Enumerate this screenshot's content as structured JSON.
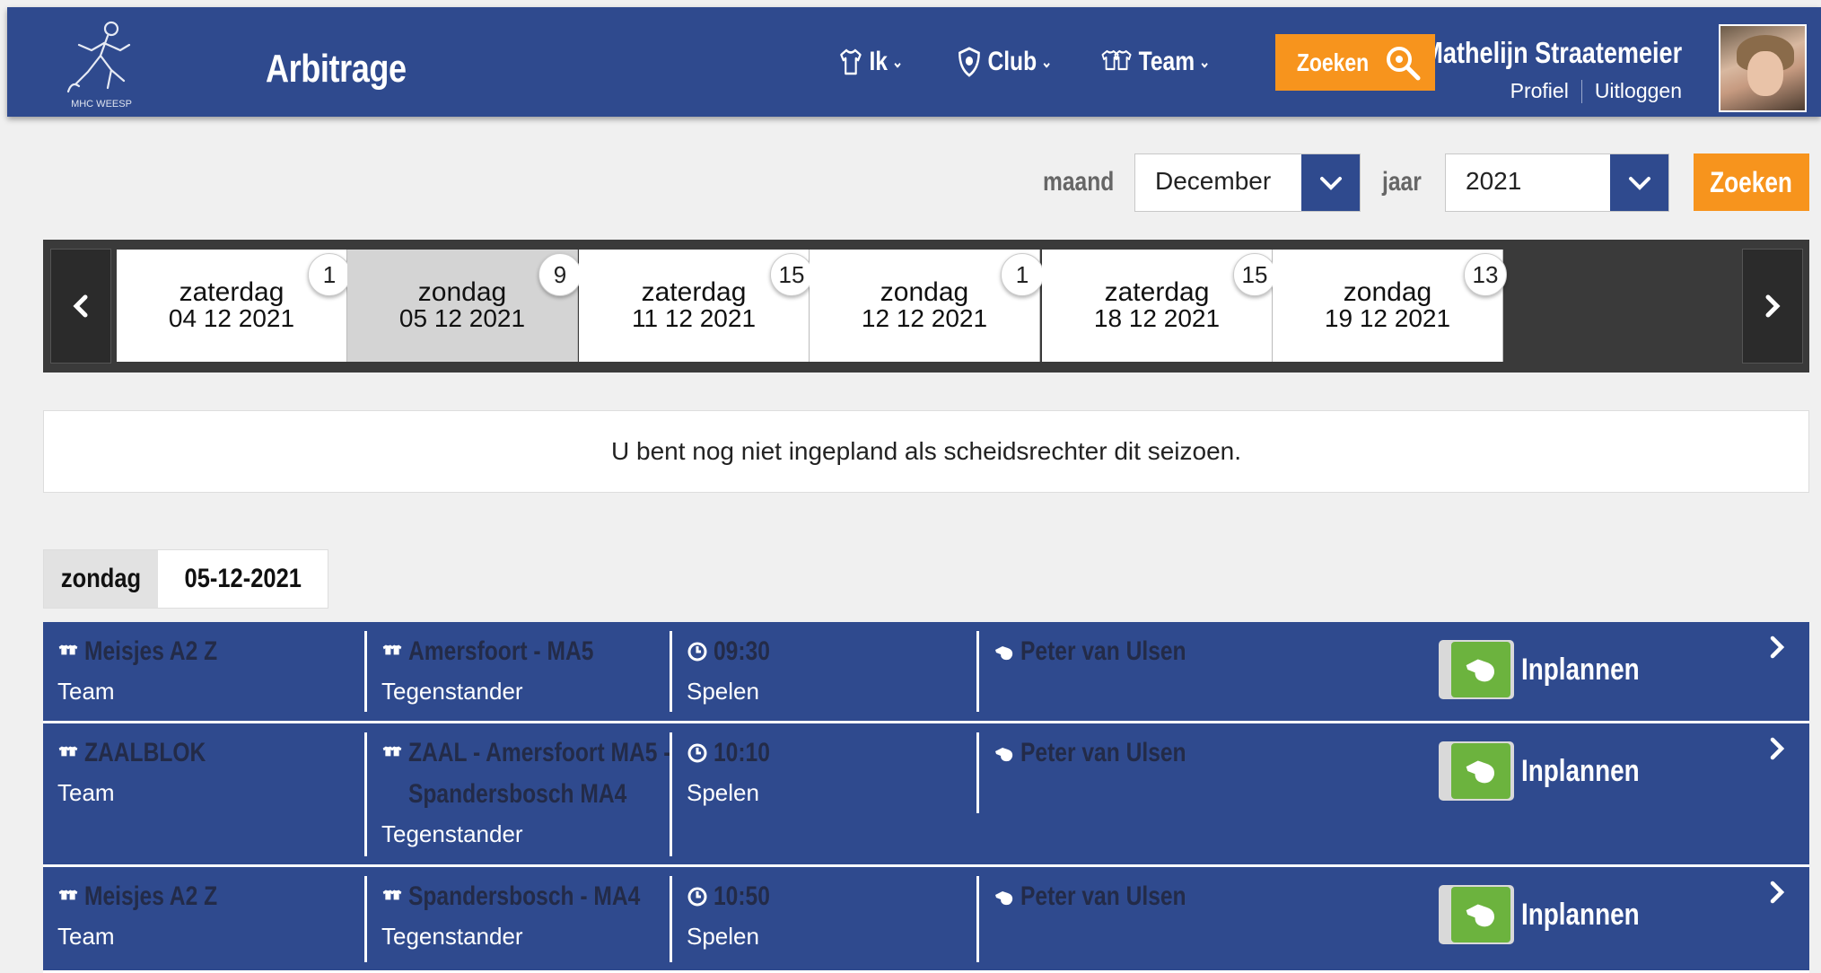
{
  "header": {
    "logo_text": "MHC WEESP",
    "title": "Arbitrage",
    "nav": [
      {
        "label": "Ik",
        "icon": "shirt-icon"
      },
      {
        "label": "Club",
        "icon": "shield-icon"
      },
      {
        "label": "Team",
        "icon": "team-shirts-icon"
      }
    ],
    "search_label": "Zoeken",
    "user_name": "Mathelijn Straatemeier",
    "profile_label": "Profiel",
    "logout_label": "Uitloggen"
  },
  "filters": {
    "month_label": "maand",
    "month_value": "December",
    "year_label": "jaar",
    "year_value": "2021",
    "search_label": "Zoeken"
  },
  "days": [
    {
      "name": "zaterdag",
      "date": "04 12 2021",
      "count": "1"
    },
    {
      "name": "zondag",
      "date": "05 12 2021",
      "count": "9",
      "active": true
    },
    {
      "name": "zaterdag",
      "date": "11 12 2021",
      "count": "15"
    },
    {
      "name": "zondag",
      "date": "12 12 2021",
      "count": "1"
    },
    {
      "name": "zaterdag",
      "date": "18 12 2021",
      "count": "15"
    },
    {
      "name": "zondag",
      "date": "19 12 2021",
      "count": "13"
    }
  ],
  "message": "U bent nog niet ingepland als scheidsrechter dit seizoen.",
  "day_header": {
    "weekday": "zondag",
    "date": "05-12-2021"
  },
  "matches": [
    {
      "team": "Meisjes A2 Z",
      "team_label": "Team",
      "opponent_line1": "Amersfoort - MA5",
      "opponent_line2": "",
      "opponent_label": "Tegenstander",
      "time": "09:30",
      "time_label": "Spelen",
      "referee": "Peter van Ulsen",
      "action": "Inplannen"
    },
    {
      "team": "ZAALBLOK",
      "team_label": "Team",
      "opponent_line1": "ZAAL - Amersfoort MA5 -",
      "opponent_line2": "Spandersbosch MA4",
      "opponent_label": "Tegenstander",
      "time": "10:10",
      "time_label": "Spelen",
      "referee": "Peter van Ulsen",
      "action": "Inplannen"
    },
    {
      "team": "Meisjes A2 Z",
      "team_label": "Team",
      "opponent_line1": "Spandersbosch - MA4",
      "opponent_line2": "",
      "opponent_label": "Tegenstander",
      "time": "10:50",
      "time_label": "Spelen",
      "referee": "Peter van Ulsen",
      "action": "Inplannen"
    }
  ],
  "colors": {
    "header_blue": "#2f4a8e",
    "accent_orange": "#f7941d",
    "toggle_green": "#6cb33e"
  }
}
